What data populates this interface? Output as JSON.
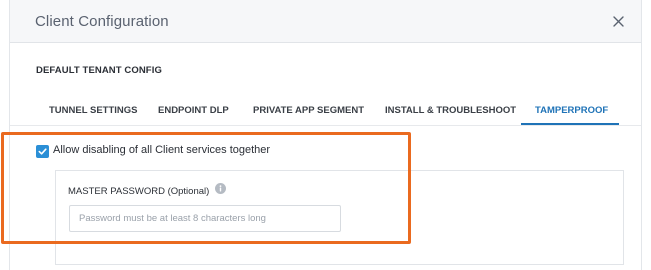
{
  "dialog": {
    "title": "Client Configuration",
    "close_icon": "close-icon"
  },
  "section": {
    "title": "DEFAULT TENANT CONFIG"
  },
  "tabs": [
    {
      "label": "TUNNEL SETTINGS",
      "active": false
    },
    {
      "label": "ENDPOINT DLP",
      "active": false
    },
    {
      "label": "PRIVATE APP SEGMENT",
      "active": false
    },
    {
      "label": "INSTALL & TROUBLESHOOT",
      "active": false
    },
    {
      "label": "TAMPERPROOF",
      "active": true
    }
  ],
  "tamperproof": {
    "allow_disable_checked": true,
    "allow_disable_label": "Allow disabling of all Client services together",
    "master_password_label": "MASTER PASSWORD (Optional)",
    "info_icon": "info-icon",
    "password_placeholder": "Password must be at least 8 characters long",
    "password_value": ""
  },
  "colors": {
    "accent": "#1f73b7",
    "checkbox": "#2b8fd6",
    "highlight": "#ea6a1f"
  }
}
